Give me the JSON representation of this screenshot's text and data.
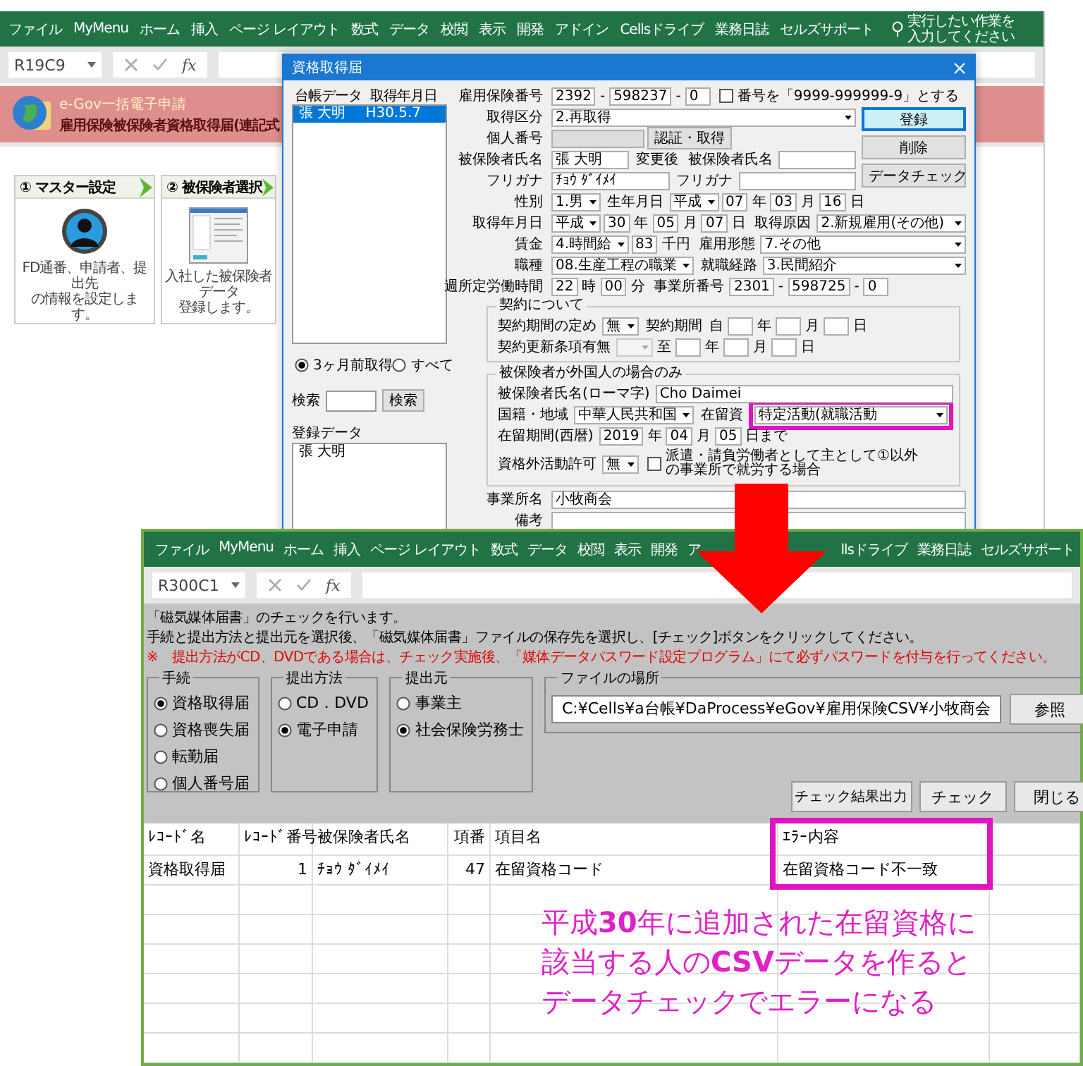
{
  "top_window": {
    "ribbon_tabs": [
      "ファイル",
      "MyMenu",
      "ホーム",
      "挿入",
      "ページ レイアウト",
      "数式",
      "データ",
      "校閲",
      "表示",
      "開発",
      "アドイン",
      "Cellsドライブ",
      "業務日誌",
      "セルズサポート"
    ],
    "tell_me": "実行したい作業を入力してください",
    "name_box": "R19C9",
    "function_label": "fx",
    "banner": {
      "subtitle": "e-Gov一括電子申請",
      "title": "雇用保険被保険者資格取得届(連記式"
    },
    "steps": [
      {
        "kind": "avatar",
        "label": "① マスター設定",
        "lines": [
          "FD通番、申請者、提出先",
          "の情報を設定します。"
        ]
      },
      {
        "kind": "thumbnail",
        "label": "② 被保険者選択",
        "lines": [
          "入社した被保険者データ",
          "登録します。"
        ]
      }
    ]
  },
  "dialog": {
    "title": "資格取得届",
    "ledger_headers": [
      "台帳データ",
      "取得年月日"
    ],
    "ledger_rows": [
      {
        "name": "張 大明",
        "date": "H30.5.7",
        "selected": true
      }
    ],
    "filters": [
      {
        "label": "3ヶ月前取得",
        "selected": true
      },
      {
        "label": "すべて",
        "selected": false
      }
    ],
    "search": {
      "label": "検索",
      "button": "検索"
    },
    "registered": {
      "label": "登録データ",
      "items": [
        "張 大明"
      ]
    },
    "buttons": [
      {
        "label": "登録",
        "default": true
      },
      {
        "label": "削除",
        "default": false
      },
      {
        "label": "データチェック",
        "default": false
      }
    ],
    "first_rows": [
      {
        "parts": [
          {
            "kind": "label",
            "text": "雇用保険番号"
          },
          {
            "kind": "num",
            "value": "2392"
          },
          {
            "kind": "sep",
            "text": "-"
          },
          {
            "kind": "num",
            "value": "598237"
          },
          {
            "kind": "sep",
            "text": "-"
          },
          {
            "kind": "num",
            "value": "0"
          },
          {
            "kind": "check",
            "label": "番号を「9999-999999-9」とする",
            "checked": false
          }
        ]
      }
    ],
    "side_rows": [
      {
        "parts": [
          {
            "kind": "label",
            "text": "取得区分"
          },
          {
            "kind": "select",
            "value": "2.再取得",
            "disabled": false,
            "highlighted": false
          }
        ]
      },
      {
        "parts": [
          {
            "kind": "label",
            "text": "個人番号"
          },
          {
            "kind": "masked"
          },
          {
            "kind": "button",
            "text": "認証・取得"
          }
        ]
      },
      {
        "parts": [
          {
            "kind": "label",
            "text": "被保険者氏名"
          },
          {
            "kind": "text",
            "value": "張 大明"
          },
          {
            "kind": "label",
            "text": "変更後"
          },
          {
            "kind": "label",
            "text": "被保険者氏名"
          },
          {
            "kind": "text"
          }
        ]
      },
      {
        "parts": [
          {
            "kind": "label",
            "text": "フリガナ"
          },
          {
            "kind": "text",
            "value": "ﾁｮｳ ﾀﾞｲﾒｲ"
          },
          {
            "kind": "label",
            "text": "フリガナ"
          },
          {
            "kind": "text"
          }
        ]
      }
    ],
    "rows": [
      {
        "parts": [
          {
            "kind": "label",
            "text": "性別"
          },
          {
            "kind": "select",
            "value": "1.男",
            "disabled": false,
            "highlighted": false
          },
          {
            "kind": "label",
            "text": "生年月日"
          },
          {
            "kind": "select",
            "value": "平成",
            "disabled": false,
            "highlighted": false
          },
          {
            "kind": "num",
            "value": "07"
          },
          {
            "kind": "unit",
            "text": "年"
          },
          {
            "kind": "num",
            "value": "03"
          },
          {
            "kind": "unit",
            "text": "月"
          },
          {
            "kind": "num",
            "value": "16"
          },
          {
            "kind": "unit",
            "text": "日"
          }
        ]
      },
      {
        "parts": [
          {
            "kind": "label",
            "text": "取得年月日"
          },
          {
            "kind": "select",
            "value": "平成",
            "disabled": false,
            "highlighted": false
          },
          {
            "kind": "num",
            "value": "30"
          },
          {
            "kind": "unit",
            "text": "年"
          },
          {
            "kind": "num",
            "value": "05"
          },
          {
            "kind": "unit",
            "text": "月"
          },
          {
            "kind": "num",
            "value": "07"
          },
          {
            "kind": "unit",
            "text": "日"
          },
          {
            "kind": "label",
            "text": "取得原因"
          },
          {
            "kind": "select",
            "value": "2.新規雇用(その他)",
            "disabled": false,
            "highlighted": false
          }
        ]
      },
      {
        "parts": [
          {
            "kind": "label",
            "text": "賃金"
          },
          {
            "kind": "select",
            "value": "4.時間給",
            "disabled": false,
            "highlighted": false
          },
          {
            "kind": "num",
            "value": "83"
          },
          {
            "kind": "unit",
            "text": "千円"
          },
          {
            "kind": "label",
            "text": "雇用形態"
          },
          {
            "kind": "select",
            "value": "7.その他",
            "disabled": false,
            "highlighted": false
          }
        ]
      },
      {
        "parts": [
          {
            "kind": "label",
            "text": "職種"
          },
          {
            "kind": "select",
            "value": "08.生産工程の職業",
            "disabled": false,
            "highlighted": false
          },
          {
            "kind": "label",
            "text": "就職経路"
          },
          {
            "kind": "select",
            "value": "3.民間紹介",
            "disabled": false,
            "highlighted": false
          }
        ]
      },
      {
        "parts": [
          {
            "kind": "label",
            "text": "週所定労働時間"
          },
          {
            "kind": "num",
            "value": "22"
          },
          {
            "kind": "unit",
            "text": "時"
          },
          {
            "kind": "num",
            "value": "00"
          },
          {
            "kind": "unit",
            "text": "分"
          },
          {
            "kind": "label",
            "text": "事業所番号"
          },
          {
            "kind": "num",
            "value": "2301"
          },
          {
            "kind": "sep",
            "text": "-"
          },
          {
            "kind": "num",
            "value": "598725"
          },
          {
            "kind": "sep",
            "text": "-"
          },
          {
            "kind": "num",
            "value": "0"
          }
        ]
      }
    ],
    "groups": [
      {
        "title": "契約について",
        "rows": [
          {
            "parts": [
              {
                "kind": "label",
                "text": "契約期間の定め"
              },
              {
                "kind": "select",
                "value": "無",
                "disabled": false,
                "highlighted": false
              },
              {
                "kind": "label",
                "text": "契約期間"
              },
              {
                "kind": "unit",
                "text": "自"
              },
              {
                "kind": "num"
              },
              {
                "kind": "unit",
                "text": "年"
              },
              {
                "kind": "num"
              },
              {
                "kind": "unit",
                "text": "月"
              },
              {
                "kind": "num"
              },
              {
                "kind": "unit",
                "text": "日"
              }
            ]
          },
          {
            "parts": [
              {
                "kind": "label",
                "text": "契約更新条項有無"
              },
              {
                "kind": "select",
                "disabled": true,
                "highlighted": false
              },
              {
                "kind": "unit",
                "text": "至"
              },
              {
                "kind": "num"
              },
              {
                "kind": "unit",
                "text": "年"
              },
              {
                "kind": "num"
              },
              {
                "kind": "unit",
                "text": "月"
              },
              {
                "kind": "num"
              },
              {
                "kind": "unit",
                "text": "日"
              }
            ]
          }
        ]
      },
      {
        "title": "被保険者が外国人の場合のみ",
        "rows": [
          {
            "parts": [
              {
                "kind": "label",
                "text": "被保険者氏名(ローマ字)"
              },
              {
                "kind": "text",
                "value": "Cho Daimei"
              }
            ]
          },
          {
            "parts": [
              {
                "kind": "label",
                "text": "国籍・地域"
              },
              {
                "kind": "select",
                "value": "中華人民共和国",
                "disabled": false,
                "highlighted": false
              },
              {
                "kind": "label",
                "text": "在留資"
              },
              {
                "kind": "select",
                "value": "特定活動(就職活動",
                "disabled": false,
                "highlighted": true
              }
            ]
          },
          {
            "parts": [
              {
                "kind": "label",
                "text": "在留期間(西暦)"
              },
              {
                "kind": "num",
                "value": "2019"
              },
              {
                "kind": "unit",
                "text": "年"
              },
              {
                "kind": "num",
                "value": "04"
              },
              {
                "kind": "unit",
                "text": "月"
              },
              {
                "kind": "num",
                "value": "05"
              },
              {
                "kind": "unit",
                "text": "日まで"
              }
            ]
          },
          {
            "parts": [
              {
                "kind": "label",
                "text": "資格外活動許可"
              },
              {
                "kind": "select",
                "value": "無",
                "disabled": false,
                "highlighted": false
              },
              {
                "kind": "check",
                "label": "派遣・請負労働者として主として①以外の事業所で就労する場合",
                "checked": false
              }
            ]
          }
        ]
      }
    ],
    "last_rows": [
      {
        "parts": [
          {
            "kind": "label",
            "text": "事業所名"
          },
          {
            "kind": "text",
            "value": "小牧商会"
          }
        ]
      },
      {
        "parts": [
          {
            "kind": "label",
            "text": "備考"
          },
          {
            "kind": "text"
          }
        ]
      }
    ]
  },
  "bottom_window": {
    "ribbon_tabs_left": [
      "ファイル",
      "MyMenu",
      "ホーム",
      "挿入",
      "ページ レイアウト",
      "数式",
      "データ",
      "校閲",
      "表示",
      "開発",
      "ア"
    ],
    "ribbon_tabs_right": [
      "llsドライブ",
      "業務日誌",
      "セルズサポート"
    ],
    "name_box": "R300C1",
    "function_label": "fx",
    "messages": [
      {
        "kind": "info",
        "text": "「磁気媒体届書」のチェックを行います。"
      },
      {
        "kind": "info",
        "text": "手続と提出方法と提出元を選択後、「磁気媒体届書」ファイルの保存先を選択し、[チェック]ボタンをクリックしてください。"
      },
      {
        "kind": "warning",
        "text": "※　提出方法がCD、DVDである場合は、チェック実施後、「媒体データパスワード設定プログラム」にて必ずパスワードを付与を行ってください。"
      }
    ],
    "option_groups": [
      {
        "title": "手続",
        "options": [
          {
            "label": "資格取得届",
            "selected": true
          },
          {
            "label": "資格喪失届",
            "selected": false
          },
          {
            "label": "転勤届",
            "selected": false
          },
          {
            "label": "個人番号届",
            "selected": false
          }
        ]
      },
      {
        "title": "提出方法",
        "options": [
          {
            "label": "CD．DVD",
            "selected": false
          },
          {
            "label": "電子申請",
            "selected": true
          }
        ]
      },
      {
        "title": "提出元",
        "options": [
          {
            "label": "事業主",
            "selected": false
          },
          {
            "label": "社会保険労務士",
            "selected": true
          }
        ]
      }
    ],
    "file_location": {
      "title": "ファイルの場所",
      "value": "C:¥Cells¥a台帳¥DaProcess¥eGov¥雇用保険CSV¥小牧商会",
      "button": "参照"
    },
    "actions": [
      "チェック結果出力",
      "チェック",
      "閉じる"
    ],
    "table": {
      "columns": [
        {
          "label": "ﾚｺｰﾄﾞ名",
          "kind": "text",
          "highlighted": false
        },
        {
          "label": "ﾚｺｰﾄﾞ番号",
          "kind": "number",
          "highlighted": false
        },
        {
          "label": "被保険者氏名",
          "kind": "text",
          "highlighted": false
        },
        {
          "label": "項番",
          "kind": "number",
          "highlighted": false
        },
        {
          "label": "項目名",
          "kind": "text",
          "highlighted": false
        },
        {
          "label": "ｴﾗｰ内容",
          "kind": "text",
          "highlighted": true
        }
      ],
      "rows": [
        [
          "資格取得届",
          "1",
          "ﾁｮｳ ﾀﾞｲﾒｲ",
          "47",
          "在留資格コード",
          "在留資格コード不一致"
        ]
      ]
    }
  },
  "caption": [
    "平成**30**年に追加された在留資格に",
    "該当する人の**CSV**データを作ると",
    "データチェックでエラーになる"
  ]
}
